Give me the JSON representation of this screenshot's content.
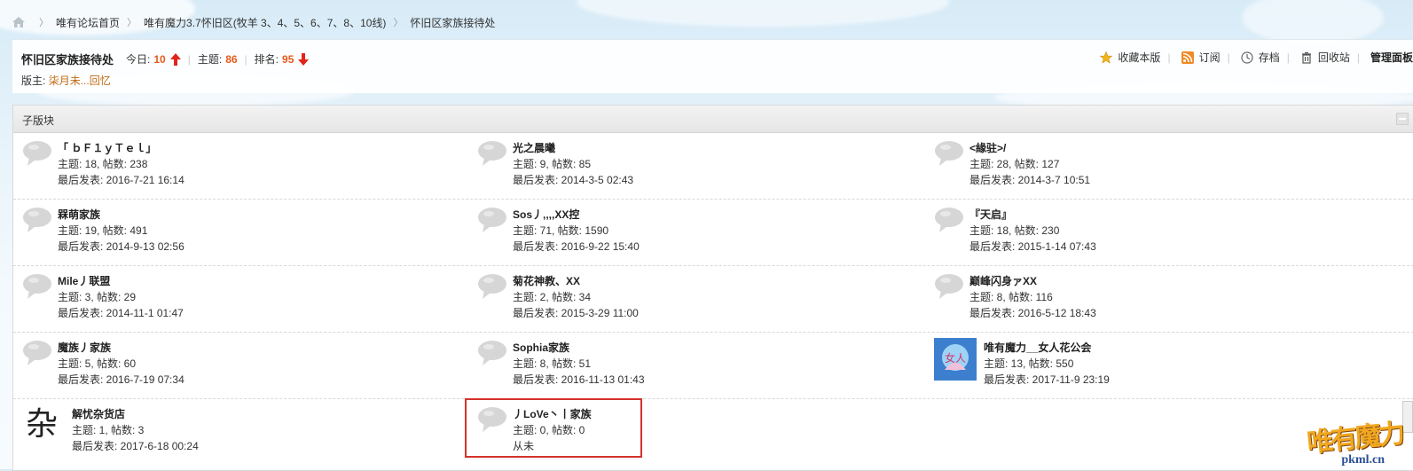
{
  "breadcrumb": {
    "items": [
      "唯有论坛首页",
      "唯有魔力3.7怀旧区(牧羊 3、4、5、6、7、8、10线)",
      "怀旧区家族接待处"
    ]
  },
  "forum": {
    "title": "怀旧区家族接待处",
    "today_label": "今日:",
    "today_value": "10",
    "topics_label": "主题:",
    "topics_value": "86",
    "rank_label": "排名:",
    "rank_value": "95",
    "moderator_label": "版主:",
    "moderator_name": "柒月未...回忆"
  },
  "actions": {
    "favorite": "收藏本版",
    "subscribe": "订阅",
    "archive": "存档",
    "recycle": "回收站",
    "manage": "管理面板"
  },
  "panel": {
    "title": "子版块"
  },
  "subforums": [
    [
      {
        "name": "「 ｂＦ１ｙＴｅｌ」",
        "stats": "主题: 18, 帖数: 238",
        "last": "最后发表: 2016-7-21 16:14",
        "icon": "speech-bubble"
      },
      {
        "name": "光之晨曦",
        "stats": "主题: 9, 帖数: 85",
        "last": "最后发表: 2014-3-5 02:43",
        "icon": "speech-bubble"
      },
      {
        "name": "<緣驻>/",
        "stats": "主题: 28, 帖数: 127",
        "last": "最后发表: 2014-3-7 10:51",
        "icon": "speech-bubble"
      }
    ],
    [
      {
        "name": "槑萌家族",
        "stats": "主题: 19, 帖数: 491",
        "last": "最后发表: 2014-9-13 02:56",
        "icon": "speech-bubble"
      },
      {
        "name": "Sos丿,,,,XX控",
        "stats": "主题: 71, 帖数: 1590",
        "last": "最后发表: 2016-9-22 15:40",
        "icon": "speech-bubble"
      },
      {
        "name": "『天启』",
        "stats": "主题: 18, 帖数: 230",
        "last": "最后发表: 2015-1-14 07:43",
        "icon": "speech-bubble"
      }
    ],
    [
      {
        "name": "Mile丿联盟",
        "stats": "主题: 3, 帖数: 29",
        "last": "最后发表: 2014-11-1 01:47",
        "icon": "speech-bubble"
      },
      {
        "name": "菊花神教、XX",
        "stats": "主题: 2, 帖数: 34",
        "last": "最后发表: 2015-3-29 11:00",
        "icon": "speech-bubble"
      },
      {
        "name": "巅峰闪身ァXX",
        "stats": "主题: 8, 帖数: 116",
        "last": "最后发表: 2016-5-12 18:43",
        "icon": "speech-bubble"
      }
    ],
    [
      {
        "name": "魔族丿家族",
        "stats": "主题: 5, 帖数: 60",
        "last": "最后发表: 2016-7-19 07:34",
        "icon": "speech-bubble"
      },
      {
        "name": "Sophia家族",
        "stats": "主题: 8, 帖数: 51",
        "last": "最后发表: 2016-11-13 01:43",
        "icon": "speech-bubble"
      },
      {
        "name": "唯有魔力__女人花公会",
        "stats": "主题: 13, 帖数: 550",
        "last": "最后发表: 2017-11-9 23:19",
        "icon": "guild-image"
      }
    ],
    [
      {
        "name": "解忧杂货店",
        "stats": "主题: 1, 帖数: 3",
        "last": "最后发表: 2017-6-18 00:24",
        "icon": "za-character",
        "icon_text": "杂"
      },
      {
        "name": "丿LoVe丶丨家族",
        "stats": "主题: 0, 帖数: 0",
        "last": "从未",
        "icon": "speech-bubble"
      }
    ]
  ],
  "logo": {
    "chars": "唯有魔力",
    "url": "pkml.cn"
  },
  "colors": {
    "accent": "#e45b1a",
    "moderator": "#c26a12",
    "highlight": "#d5322c"
  }
}
